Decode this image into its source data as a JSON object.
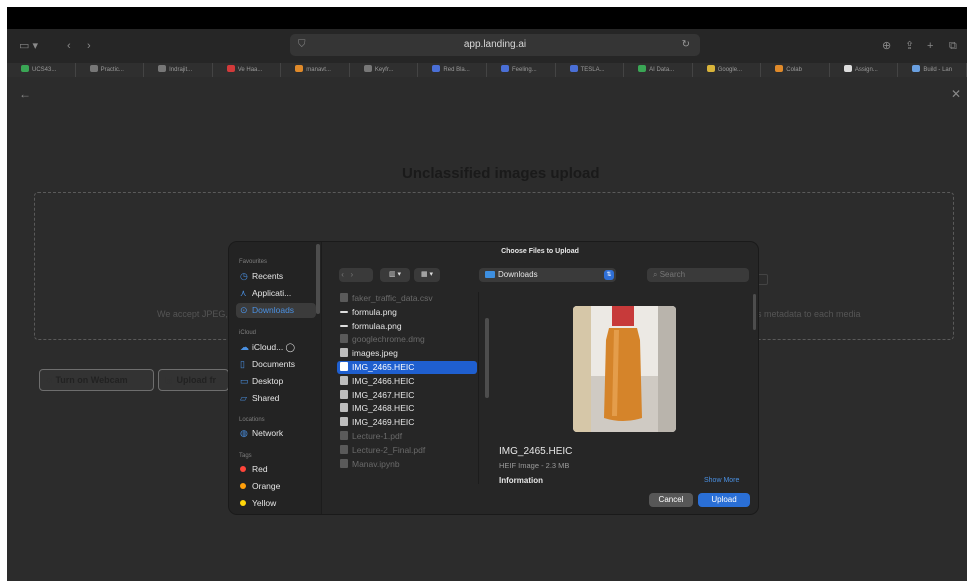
{
  "browser": {
    "url": "app.landing.ai",
    "tabs": [
      {
        "label": "UCS43...",
        "color": "#3aa655"
      },
      {
        "label": "Practic...",
        "color": "#777777"
      },
      {
        "label": "Indrajit...",
        "color": "#777777"
      },
      {
        "label": "Ve Haa...",
        "color": "#d23a3a"
      },
      {
        "label": "manavt...",
        "color": "#e08a2a"
      },
      {
        "label": "Keyfr...",
        "color": "#777777"
      },
      {
        "label": "Red Bla...",
        "color": "#4a6fd6"
      },
      {
        "label": "Feeling...",
        "color": "#4a6fd6"
      },
      {
        "label": "TESLA...",
        "color": "#4a6fd6"
      },
      {
        "label": "AI Data...",
        "color": "#3aa655"
      },
      {
        "label": "Google...",
        "color": "#d9b43a"
      },
      {
        "label": "Colab",
        "color": "#e08a2a"
      },
      {
        "label": "Assign...",
        "color": "#dddddd"
      },
      {
        "label": "Build - Lan",
        "color": "#6aa0e0"
      }
    ]
  },
  "page": {
    "title": "Unclassified images upload",
    "accept_text": "We accept JPEG,",
    "metadata_text": "s metadata to each media",
    "webcam_button": "Turn on Webcam",
    "upload_from_button": "Upload fr"
  },
  "dialog": {
    "title": "Choose Files to Upload",
    "location": "Downloads",
    "search_placeholder": "Search",
    "sidebar": {
      "favourites_heading": "Favourites",
      "favourites": [
        {
          "label": "Recents",
          "icon": "clock-icon"
        },
        {
          "label": "Applicati...",
          "icon": "applications-icon"
        },
        {
          "label": "Downloads",
          "icon": "downloads-icon"
        }
      ],
      "icloud_heading": "iCloud",
      "icloud": [
        {
          "label": "iCloud... ◯",
          "icon": "cloud-icon"
        },
        {
          "label": "Documents",
          "icon": "document-icon"
        },
        {
          "label": "Desktop",
          "icon": "desktop-icon"
        },
        {
          "label": "Shared",
          "icon": "shared-folder-icon"
        }
      ],
      "locations_heading": "Locations",
      "locations": [
        {
          "label": "Network",
          "icon": "network-icon"
        }
      ],
      "tags_heading": "Tags",
      "tags": [
        {
          "label": "Red",
          "color": "#ff453a"
        },
        {
          "label": "Orange",
          "color": "#ff9f0a"
        },
        {
          "label": "Yellow",
          "color": "#ffd60a"
        }
      ]
    },
    "files": [
      {
        "name": "faker_traffic_data.csv",
        "enabled": false
      },
      {
        "name": "formula.png",
        "enabled": true
      },
      {
        "name": "formulaa.png",
        "enabled": true
      },
      {
        "name": "googlechrome.dmg",
        "enabled": false
      },
      {
        "name": "images.jpeg",
        "enabled": true
      },
      {
        "name": "IMG_2465.HEIC",
        "enabled": true,
        "selected": true
      },
      {
        "name": "IMG_2466.HEIC",
        "enabled": true
      },
      {
        "name": "IMG_2467.HEIC",
        "enabled": true
      },
      {
        "name": "IMG_2468.HEIC",
        "enabled": true
      },
      {
        "name": "IMG_2469.HEIC",
        "enabled": true
      },
      {
        "name": "Lecture-1.pdf",
        "enabled": false
      },
      {
        "name": "Lecture-2_Final.pdf",
        "enabled": false
      },
      {
        "name": "Manav.ipynb",
        "enabled": false
      }
    ],
    "preview": {
      "filename": "IMG_2465.HEIC",
      "info": "HEIF Image - 2.3 MB",
      "section": "Information",
      "show_more": "Show More"
    },
    "cancel_label": "Cancel",
    "upload_label": "Upload"
  }
}
